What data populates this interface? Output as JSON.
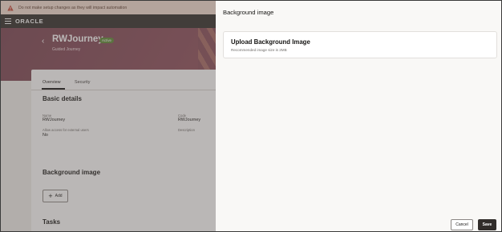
{
  "warning": {
    "text": "Do not make setup changes as they will impact automation"
  },
  "brand": {
    "name": "ORACLE"
  },
  "journey": {
    "title": "RWJourney",
    "status": "Active",
    "subtitle": "Guided Journey"
  },
  "tabs": [
    {
      "label": "Overview"
    },
    {
      "label": "Security"
    }
  ],
  "basic_details": {
    "heading": "Basic details",
    "name_label": "Name",
    "name_value": "RWJourney",
    "code_label": "Code",
    "code_value": "RWJourney",
    "external_label": "Allow access for external users",
    "external_value": "No",
    "description_label": "Description"
  },
  "background_section": {
    "heading": "Background image",
    "add_label": "Add"
  },
  "tasks": {
    "heading": "Tasks"
  },
  "drawer": {
    "title": "Background image",
    "upload_title": "Upload Background Image",
    "upload_hint": "Recommended image size is 2MB",
    "cancel_label": "Cancel",
    "save_label": "Save"
  },
  "colors": {
    "nav": "#312d2a",
    "badge": "#5d8a35",
    "warning_bg": "#f4ded2",
    "save_bg": "#312d2a"
  }
}
